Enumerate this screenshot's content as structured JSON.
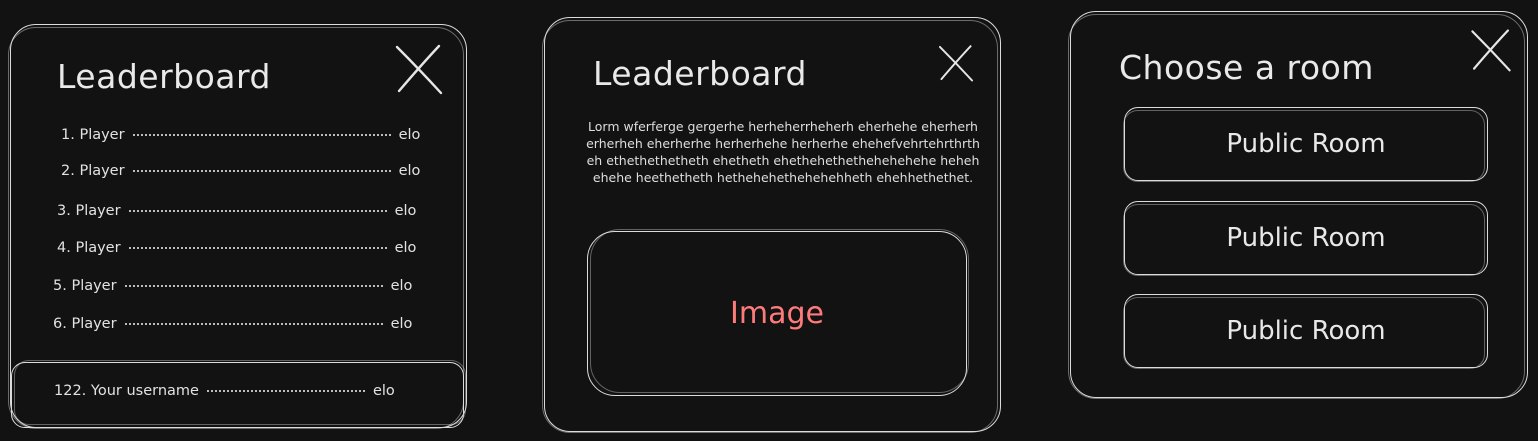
{
  "colors": {
    "background": "#121212",
    "stroke": "#dcdcdc",
    "text": "#e6e6e6",
    "image_label": "#ff7b7b"
  },
  "leaderboard": {
    "title": "Leaderboard",
    "close_icon": "close-x-icon",
    "rows": [
      {
        "name": "1. Player",
        "score": "elo"
      },
      {
        "name": "2. Player",
        "score": "elo"
      },
      {
        "name": "3. Player",
        "score": "elo"
      },
      {
        "name": "4. Player",
        "score": "elo"
      },
      {
        "name": "5. Player",
        "score": "elo"
      },
      {
        "name": "6. Player",
        "score": "elo"
      }
    ],
    "user_row": {
      "name": "122. Your username",
      "score": "elo"
    }
  },
  "info": {
    "title": "Leaderboard",
    "close_icon": "close-x-icon",
    "description": "Lorm wferferge gergerhe herheherrheherh eherhehe eherherherherheh eherherhe herherhehe herherhe ehehefvehrtehrthrtheh ethethethetheth ehetheth ehethehethethehehehehe hehehehehe heethetheth hethehehethehehehheth ehehhethethet.",
    "image_label": "Image"
  },
  "rooms": {
    "title": "Choose a room",
    "close_icon": "close-x-icon",
    "buttons": [
      "Public Room",
      "Public Room",
      "Public Room"
    ]
  }
}
